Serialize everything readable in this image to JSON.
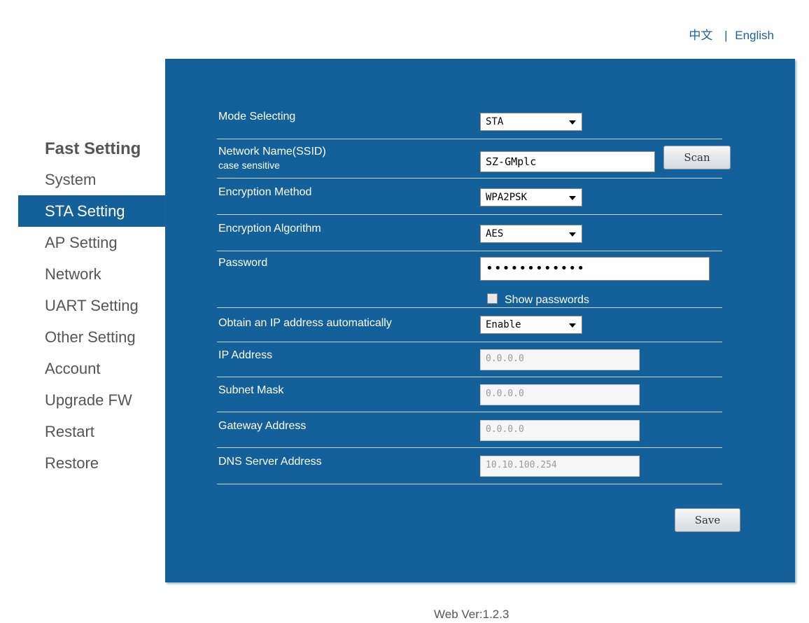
{
  "lang": {
    "chinese": "中文",
    "separator": "|",
    "english": "English"
  },
  "sidebar": {
    "title": "Fast Setting",
    "items": [
      {
        "label": "System"
      },
      {
        "label": "STA Setting",
        "active": true
      },
      {
        "label": "AP Setting"
      },
      {
        "label": "Network"
      },
      {
        "label": "UART Setting"
      },
      {
        "label": "Other Setting"
      },
      {
        "label": "Account"
      },
      {
        "label": "Upgrade FW"
      },
      {
        "label": "Restart"
      },
      {
        "label": "Restore"
      }
    ]
  },
  "form": {
    "mode": {
      "label": "Mode Selecting",
      "value": "STA"
    },
    "ssid": {
      "label": "Network Name(SSID)",
      "sublabel": "case sensitive",
      "value": "SZ-GMplc",
      "scan_label": "Scan"
    },
    "enc_method": {
      "label": "Encryption Method",
      "value": "WPA2PSK"
    },
    "enc_algo": {
      "label": "Encryption Algorithm",
      "value": "AES"
    },
    "password": {
      "label": "Password",
      "value": "••••••••••••",
      "show_label": "Show passwords"
    },
    "dhcp": {
      "label": "Obtain an IP address automatically",
      "value": "Enable"
    },
    "ip": {
      "label": "IP Address",
      "value": "0.0.0.0"
    },
    "mask": {
      "label": "Subnet Mask",
      "value": "0.0.0.0"
    },
    "gateway": {
      "label": "Gateway Address",
      "value": "0.0.0.0"
    },
    "dns": {
      "label": "DNS Server Address",
      "value": "10.10.100.254"
    },
    "save_label": "Save"
  },
  "footer": {
    "version": "Web Ver:1.2.3"
  },
  "colors": {
    "panel": "#13609a",
    "link": "#1d5f97"
  }
}
